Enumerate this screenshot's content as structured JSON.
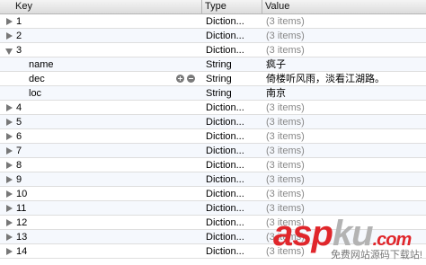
{
  "header": {
    "key": "Key",
    "type": "Type",
    "value": "Value"
  },
  "rows": [
    {
      "key": "1",
      "type": "Diction...",
      "value": "(3 items)"
    },
    {
      "key": "2",
      "type": "Diction...",
      "value": "(3 items)"
    },
    {
      "key": "3",
      "type": "Diction...",
      "value": "(3 items)"
    },
    {
      "key": "name",
      "type": "String",
      "value": "疯子"
    },
    {
      "key": "dec",
      "type": "String",
      "value": "倚楼听风雨，淡看江湖路。"
    },
    {
      "key": "loc",
      "type": "String",
      "value": "南京"
    },
    {
      "key": "4",
      "type": "Diction...",
      "value": "(3 items)"
    },
    {
      "key": "5",
      "type": "Diction...",
      "value": "(3 items)"
    },
    {
      "key": "6",
      "type": "Diction...",
      "value": "(3 items)"
    },
    {
      "key": "7",
      "type": "Diction...",
      "value": "(3 items)"
    },
    {
      "key": "8",
      "type": "Diction...",
      "value": "(3 items)"
    },
    {
      "key": "9",
      "type": "Diction...",
      "value": "(3 items)"
    },
    {
      "key": "10",
      "type": "Diction...",
      "value": "(3 items)"
    },
    {
      "key": "11",
      "type": "Diction...",
      "value": "(3 items)"
    },
    {
      "key": "12",
      "type": "Diction...",
      "value": "(3 items)"
    },
    {
      "key": "13",
      "type": "Diction...",
      "value": "(3 items)"
    },
    {
      "key": "14",
      "type": "Diction...",
      "value": "(3 items)"
    }
  ],
  "watermark": {
    "red_text": "asp",
    "grey_text": "ku",
    "domain": ".com",
    "sub": "免费网站源码下载站!"
  },
  "colors": {
    "accent_red": "#e0262b",
    "muted_text": "#888888",
    "alt_row": "#f5f8fd"
  },
  "icons": [
    "disclosure-triangle-icon",
    "add-row-icon",
    "remove-row-icon"
  ]
}
